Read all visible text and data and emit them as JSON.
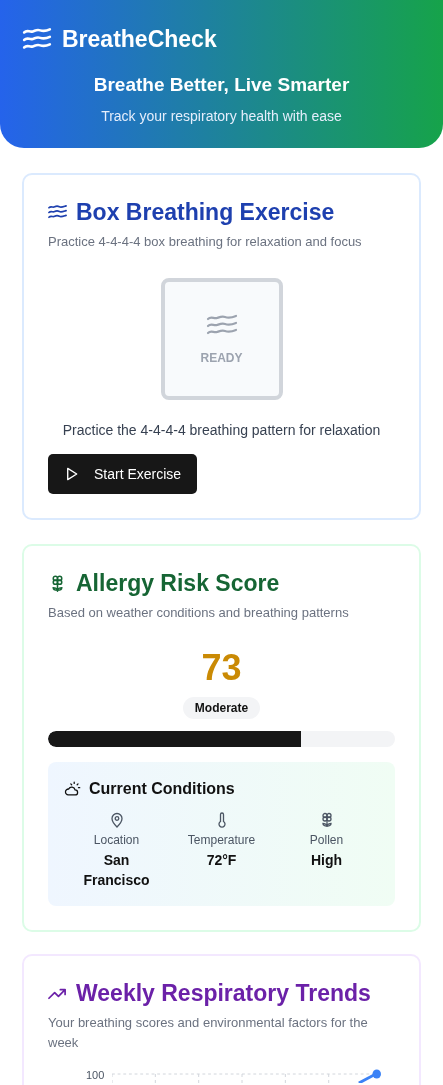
{
  "header": {
    "app_name": "BreatheCheck",
    "tagline": "Breathe Better, Live Smarter",
    "subtitle": "Track your respiratory health with ease"
  },
  "breathing": {
    "title": "Box Breathing Exercise",
    "description": "Practice 4-4-4-4 box breathing for relaxation and focus",
    "phase": "READY",
    "instruction": "Practice the 4-4-4-4 breathing pattern for relaxation",
    "button": "Start Exercise"
  },
  "allergy": {
    "title": "Allergy Risk Score",
    "description": "Based on weather conditions and breathing patterns",
    "score": "73",
    "risk_label": "Moderate",
    "level": 0.73,
    "conditions": {
      "title": "Current Conditions",
      "items": [
        {
          "kind": "location",
          "label": "Location",
          "value": "San Francisco"
        },
        {
          "kind": "temperature",
          "label": "Temperature",
          "value": "72°F"
        },
        {
          "kind": "pollen",
          "label": "Pollen",
          "value": "High"
        }
      ]
    }
  },
  "trends": {
    "title": "Weekly Respiratory Trends",
    "description": "Your breathing scores and environmental factors for the week",
    "y_tick": "100"
  }
}
